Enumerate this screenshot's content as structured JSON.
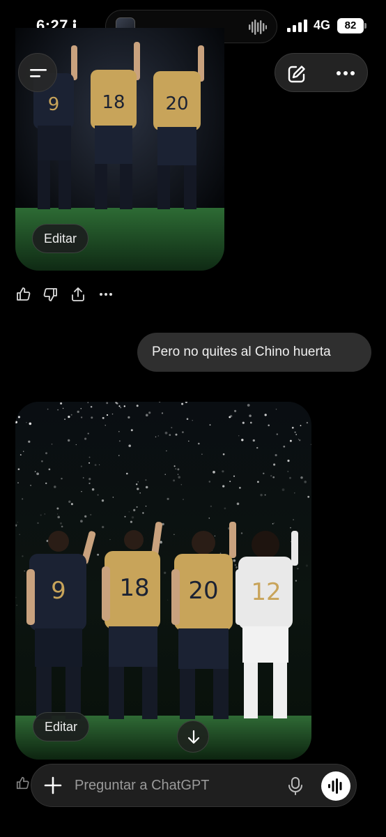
{
  "status_bar": {
    "time": "6:27",
    "network": "4G",
    "battery": "82"
  },
  "top_bar": {
    "menu_icon": "sidebar-menu-icon",
    "compose_icon": "new-chat-icon",
    "more_icon": "more-dots-icon"
  },
  "messages": {
    "image1": {
      "jersey_numbers": [
        "9",
        "18",
        "20"
      ],
      "edit_label": "Editar"
    },
    "actions": [
      "thumbs-up-icon",
      "thumbs-down-icon",
      "share-icon",
      "more-dots-icon"
    ],
    "user_message": "Pero no quites al Chino huerta",
    "image2": {
      "jersey_numbers": [
        "9",
        "18",
        "20",
        "12"
      ],
      "edit_label": "Editar"
    }
  },
  "composer": {
    "placeholder": "Preguntar a ChatGPT"
  },
  "colors": {
    "background": "#000000",
    "bubble": "#2f2f2f",
    "jersey_dark": "#1b2233",
    "jersey_gold": "#c8a45a",
    "jersey_white": "#e9e9e9",
    "pitch": "#1f4a25"
  }
}
